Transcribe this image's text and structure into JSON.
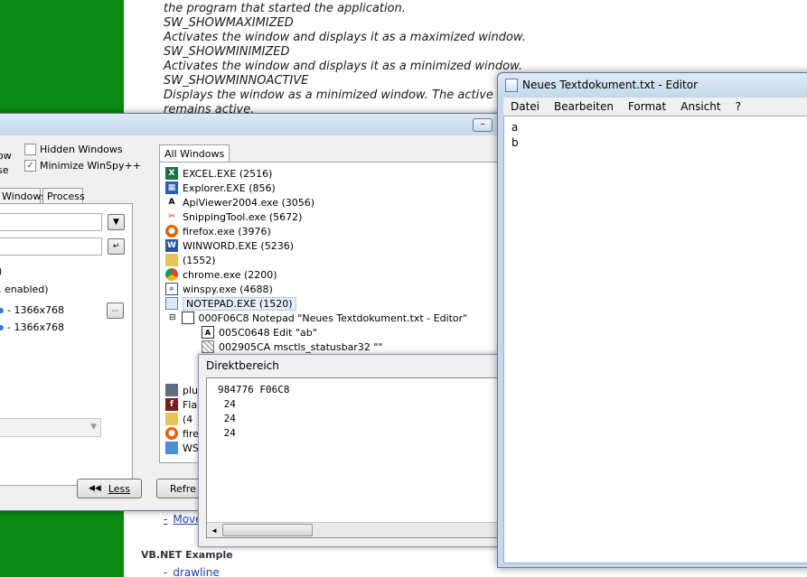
{
  "doc": {
    "lines": [
      "the program that started the application.",
      "SW_SHOWMAXIMIZED",
      "Activates the window and displays it as a maximized window.",
      "SW_SHOWMINIMIZED",
      "Activates the window and displays it as a minimized window.",
      "SW_SHOWMINNOACTIVE",
      "Displays the window as a minimized window. The active",
      "remains active."
    ],
    "link_move": "Move",
    "heading_vbnet": "VB.NET Example",
    "link_drawline": "drawline"
  },
  "winspy": {
    "min_symbol": "–",
    "left_label_1": "ow",
    "left_label_2": "se",
    "hidden_windows_label": "Hidden Windows",
    "minimize_label": "Minimize WinSpy++",
    "minimize_checked": "✓",
    "tab_windows": "Windows",
    "tab_process": "Process",
    "info_paren": ")",
    "info_enabled": ", enabled)",
    "res1": "-  1366x768",
    "res2": "-  1366x768",
    "ellipsis_btn": "···",
    "less_button": "Less",
    "refresh_button": "Refre",
    "all_windows_tab": "All Windows",
    "tree": [
      {
        "label": "EXCEL.EXE  (2516)",
        "icon": "excel-icon"
      },
      {
        "label": "Explorer.EXE  (856)",
        "icon": "explorer-icon"
      },
      {
        "label": "ApiViewer2004.exe  (3056)",
        "icon": "apiviewer-icon"
      },
      {
        "label": "SnippingTool.exe  (5672)",
        "icon": "snipping-tool-icon"
      },
      {
        "label": "firefox.exe  (3976)",
        "icon": "firefox-icon"
      },
      {
        "label": "WINWORD.EXE  (5236)",
        "icon": "word-icon"
      },
      {
        "label": " (1552)",
        "icon": "folder-icon"
      },
      {
        "label": "chrome.exe  (2200)",
        "icon": "chrome-icon"
      },
      {
        "label": "winspy.exe  (4688)",
        "icon": "winspy-icon"
      },
      {
        "label": "NOTEPAD.EXE  (1520)",
        "icon": "notepad-icon"
      }
    ],
    "tree_child_window": "000F06C8  Notepad  \"Neues Textdokument.txt - Editor\"",
    "tree_child_edit": "005C0648  Edit  \"ab\"",
    "tree_child_status": "002905CA  msctls_statusbar32  \"\"",
    "tree_lower": [
      "plu",
      "Fla",
      "(4",
      "fire",
      "WS"
    ]
  },
  "direkt": {
    "title": "Direktbereich",
    "lines": [
      "984776 F06C8",
      " 24",
      " 24",
      " 24"
    ]
  },
  "notepad": {
    "title": "Neues Textdokument.txt - Editor",
    "menu": [
      "Datei",
      "Bearbeiten",
      "Format",
      "Ansicht",
      "?"
    ],
    "text_lines": [
      "a",
      "b"
    ]
  }
}
